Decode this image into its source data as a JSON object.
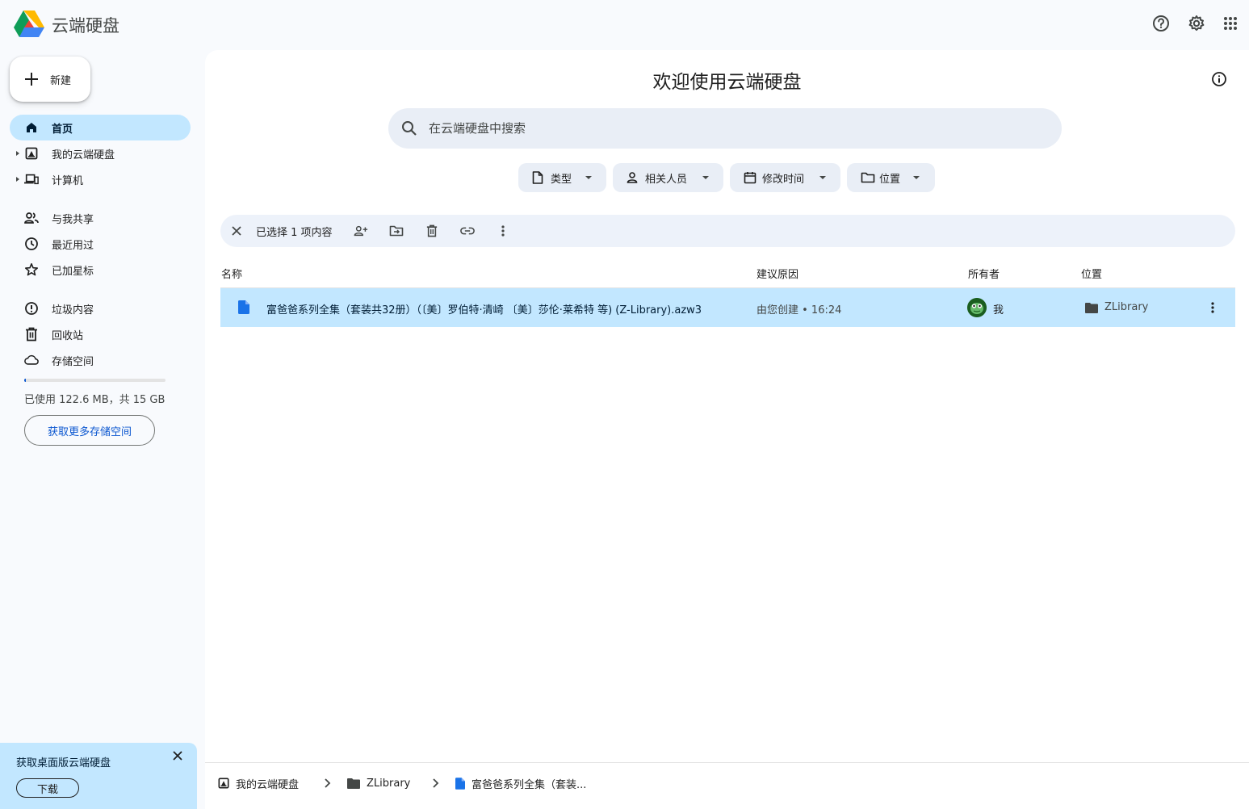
{
  "app": {
    "title": "云端硬盘"
  },
  "topbar": {
    "icons": [
      "help-icon",
      "settings-icon",
      "apps-grid-icon"
    ]
  },
  "sidebar": {
    "new_label": "新建",
    "items": [
      {
        "label": "首页",
        "icon": "home-icon",
        "active": true
      },
      {
        "label": "我的云端硬盘",
        "icon": "my-drive-icon",
        "expandable": true
      },
      {
        "label": "计算机",
        "icon": "computers-icon",
        "expandable": true
      },
      {
        "label": "与我共享",
        "icon": "shared-icon"
      },
      {
        "label": "最近用过",
        "icon": "recent-icon"
      },
      {
        "label": "已加星标",
        "icon": "star-icon"
      },
      {
        "label": "垃圾内容",
        "icon": "spam-icon"
      },
      {
        "label": "回收站",
        "icon": "trash-icon"
      },
      {
        "label": "存储空间",
        "icon": "cloud-icon"
      }
    ],
    "storage": {
      "used_fraction": 0.008,
      "text": "已使用 122.6 MB，共 15 GB",
      "button": "获取更多存储空间"
    },
    "promo": {
      "title": "获取桌面版云端硬盘",
      "button": "下载"
    }
  },
  "main": {
    "welcome": "欢迎使用云端硬盘",
    "search": {
      "placeholder": "在云端硬盘中搜索"
    },
    "chips": [
      {
        "label": "类型",
        "icon": "file-type-icon"
      },
      {
        "label": "相关人员",
        "icon": "person-icon"
      },
      {
        "label": "修改时间",
        "icon": "calendar-icon"
      },
      {
        "label": "位置",
        "icon": "folder-outline-icon"
      }
    ],
    "selection": {
      "text": "已选择 1 项内容"
    },
    "columns": {
      "name": "名称",
      "reason": "建议原因",
      "owner": "所有者",
      "location": "位置"
    },
    "files": [
      {
        "name": "富爸爸系列全集（套装共32册）（〔美〕罗伯特·清崎 〔美〕莎伦·莱希特 等) (Z-Library).azw3",
        "reason": "由您创建 • 16:24",
        "owner": "我",
        "location": "ZLibrary"
      }
    ],
    "breadcrumb": [
      "我的云端硬盘",
      "ZLibrary",
      "富爸爸系列全集（套装..."
    ]
  },
  "colors": {
    "accent": "#0b57d0",
    "selected": "#c2e7ff",
    "surface": "#f8fafd",
    "chip": "#e9eef6"
  }
}
